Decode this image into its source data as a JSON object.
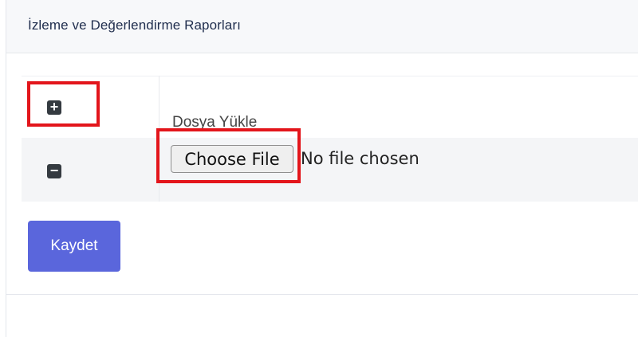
{
  "header": {
    "title": "İzleme ve Değerlendirme Raporları"
  },
  "upload": {
    "label": "Dosya Yükle",
    "file_button": "Choose File",
    "file_status": "No file chosen"
  },
  "icons": {
    "add": "+",
    "remove": "−"
  },
  "actions": {
    "save_label": "Kaydet"
  },
  "colors": {
    "primary": "#5a66dc",
    "highlight": "#e3151b",
    "icon_bg": "#343a40"
  }
}
